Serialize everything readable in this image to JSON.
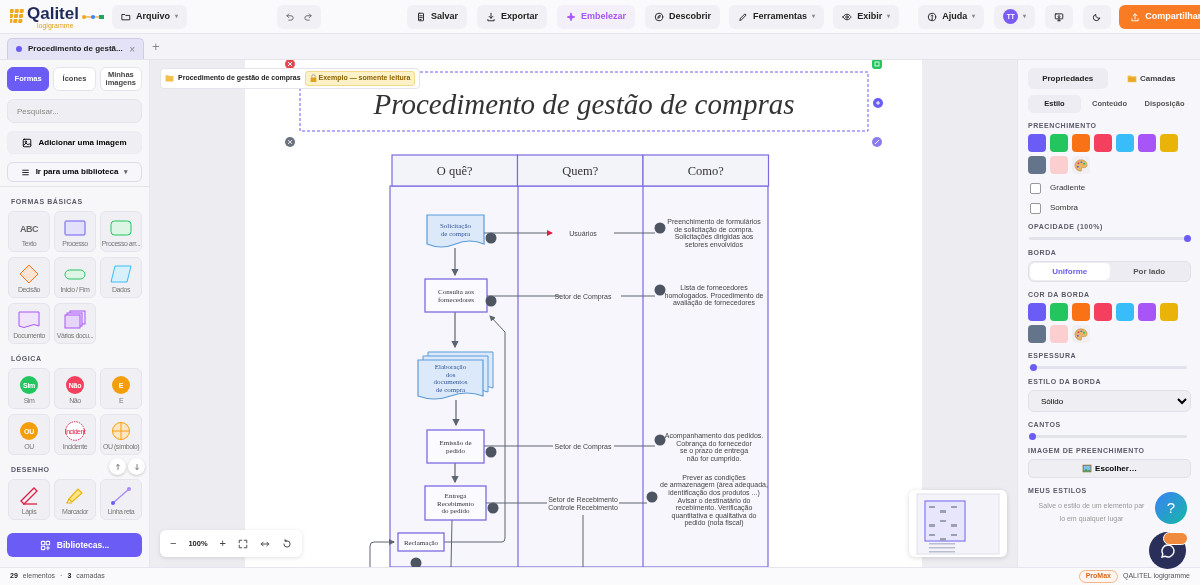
{
  "logo": {
    "name": "Qalitel",
    "tagline": "logigramme"
  },
  "toolbar": [
    {
      "kind": "menu",
      "label": "Arquivo",
      "caret": "▾"
    },
    {
      "kind": "history"
    },
    {
      "kind": "button",
      "label": "Salvar"
    },
    {
      "kind": "button",
      "label": "Exportar"
    },
    {
      "kind": "accent",
      "label": "Embelezar"
    },
    {
      "kind": "button",
      "label": "Descobrir"
    },
    {
      "kind": "menu",
      "label": "Ferramentas",
      "caret": "▾"
    },
    {
      "kind": "menu",
      "label": "Exibir",
      "caret": "▾"
    },
    {
      "kind": "menu",
      "label": "Ajuda",
      "caret": "▾"
    },
    {
      "kind": "avatar",
      "initials": "TT",
      "caret": "▾"
    },
    {
      "kind": "icon"
    },
    {
      "kind": "icon"
    },
    {
      "kind": "primary",
      "label": "Compartilhar"
    }
  ],
  "document_tabs": [
    {
      "label": "Procedimento de gestã...",
      "selected": true,
      "close": "×"
    }
  ],
  "new_tab": "+",
  "sidebar": {
    "tabs": [
      {
        "label": "Formas",
        "selected": true
      },
      {
        "label": "Ícones",
        "selected": false
      },
      {
        "label": "Minhas imagens",
        "selected": false
      }
    ],
    "search": {
      "placeholder": "Pesquisar..."
    },
    "add_image": "Adicionar uma imagem",
    "library_menu": {
      "label": "Ir para uma biblioteca",
      "caret": "▾"
    },
    "sections": [
      {
        "title": "FORMAS BÁSICAS",
        "items": [
          {
            "label": "Texto",
            "kind": "text",
            "glyph": "ABC"
          },
          {
            "label": "Processo",
            "kind": "process"
          },
          {
            "label": "Processo arr...",
            "kind": "rounded"
          },
          {
            "label": "Decisão",
            "kind": "decision"
          },
          {
            "label": "Início / Fim",
            "kind": "terminal"
          },
          {
            "label": "Dados",
            "kind": "data"
          },
          {
            "label": "Documento",
            "kind": "document"
          },
          {
            "label": "Vários docu...",
            "kind": "documents"
          }
        ]
      },
      {
        "title": "LÓGICA",
        "items": [
          {
            "label": "Sim",
            "kind": "badge",
            "glyph": "Sim",
            "color": "#22c55e"
          },
          {
            "label": "Não",
            "kind": "badge",
            "glyph": "Não",
            "color": "#f43f5e"
          },
          {
            "label": "E",
            "kind": "badge",
            "glyph": "E",
            "color": "#f59e0b"
          },
          {
            "label": "OU",
            "kind": "badge",
            "glyph": "OU",
            "color": "#f59e0b"
          },
          {
            "label": "Incidente",
            "kind": "incident",
            "glyph": "Incident"
          },
          {
            "label": "OU (símbolo)",
            "kind": "or-symbol"
          }
        ]
      },
      {
        "title": "DESENHO",
        "items": [
          {
            "label": "Lápis",
            "kind": "pencil"
          },
          {
            "label": "Marcador",
            "kind": "marker"
          },
          {
            "label": "Linha reta",
            "kind": "line"
          }
        ]
      }
    ],
    "libraries_button": "Bibliotecas..."
  },
  "status": {
    "count": "29",
    "count_label": "elementos",
    "separator": "·",
    "layers": "3",
    "layers_label": "camadas"
  },
  "canvas": {
    "breadcrumb": "Procedimento de gestão de compras",
    "readonly_badge": "Exemplo — somente leitura",
    "title": "Procedimento de gestão de compras",
    "diagram": {
      "columns": [
        "O quê?",
        "Quem?",
        "Como?"
      ],
      "steps": [
        {
          "kind": "document",
          "text": "Solicitação\nde compra"
        },
        {
          "kind": "process",
          "text": "Consulta aos\nfornecedores"
        },
        {
          "kind": "multidocument",
          "text": "Elaboração\ndos\ndocumentos\nde compra"
        },
        {
          "kind": "process",
          "text": "Emissão de\npedido"
        },
        {
          "kind": "process",
          "text": "Entrega\nRecebimento\ndo pedido"
        },
        {
          "kind": "process",
          "text": "Reclamação"
        }
      ],
      "rows": [
        {
          "who": "Usuários",
          "how": "Preenchimento de formulários\nde solicitação de compra.\nSolicitações dirigidas aos\nsetores envolvidos"
        },
        {
          "who": "Setor de Compras",
          "how": "Lista de fornecedores\nhomologados. Procedimento de\navaliação de fornecedores"
        },
        {
          "who": "Setor de Compras",
          "how": "Acompanhamento dos pedidos.\nCobrança do fornecedor\nse o prazo de entrega\nnão for cumprido."
        },
        {
          "who": "Setor de Recebimento\nControle Recebimento",
          "how": "Prever as condições\nde armazenagem (área adequada,\nidentificação dos produtos ...)\nAvisar o destinatário do\nrecebimento. Verificação\nquantitativa e qualitativa do\npedido (nota fiscal)"
        }
      ]
    }
  },
  "zoom": {
    "minus": "−",
    "level": "100%",
    "plus": "+"
  },
  "properties": {
    "tabs": [
      {
        "label": "Propriedades",
        "selected": true
      },
      {
        "label": "Camadas",
        "selected": false
      }
    ],
    "subtabs": [
      {
        "label": "Estilo",
        "selected": true
      },
      {
        "label": "Conteúdo",
        "selected": false
      },
      {
        "label": "Disposição",
        "selected": false
      }
    ],
    "fill": {
      "title": "PREENCHIMENTO",
      "swatches": [
        {
          "kind": "color",
          "color": "#6a5cf5"
        },
        {
          "kind": "color",
          "color": "#22c55e"
        },
        {
          "kind": "color",
          "color": "#f97316"
        },
        {
          "kind": "color",
          "color": "#f43f5e"
        },
        {
          "kind": "color",
          "color": "#38bdf8"
        },
        {
          "kind": "color",
          "color": "#a855f7"
        },
        {
          "kind": "color",
          "color": "#eab308"
        },
        {
          "kind": "color",
          "color": "#64748b"
        },
        {
          "kind": "color",
          "color": "#fbcfcf"
        },
        {
          "kind": "palette"
        }
      ]
    },
    "options": [
      {
        "label": "Gradiente",
        "checked": false
      },
      {
        "label": "Sombra",
        "checked": false
      }
    ],
    "opacity": {
      "title": "OPACIDADE (100%)",
      "level": 1
    },
    "border": {
      "title": "BORDA",
      "modes": [
        {
          "label": "Uniforme",
          "selected": true
        },
        {
          "label": "Por lado",
          "selected": false
        }
      ]
    },
    "border_color": {
      "title": "COR DA BORDA",
      "swatches": [
        {
          "kind": "color",
          "color": "#6a5cf5"
        },
        {
          "kind": "color",
          "color": "#22c55e"
        },
        {
          "kind": "color",
          "color": "#f97316"
        },
        {
          "kind": "color",
          "color": "#f43f5e"
        },
        {
          "kind": "color",
          "color": "#38bdf8"
        },
        {
          "kind": "color",
          "color": "#a855f7"
        },
        {
          "kind": "color",
          "color": "#eab308"
        },
        {
          "kind": "color",
          "color": "#64748b"
        },
        {
          "kind": "color",
          "color": "#fbcfcf"
        },
        {
          "kind": "palette"
        }
      ]
    },
    "thickness": {
      "title": "ESPESSURA",
      "level": 0.03
    },
    "border_style": {
      "title": "ESTILO DA BORDA",
      "value": "Sólido"
    },
    "corners": {
      "title": "CANTOS",
      "level": 0.02
    },
    "fill_image": {
      "title": "IMAGEM DE PREENCHIMENTO",
      "button": "Escolher…"
    },
    "my_styles": {
      "title": "MEUS ESTILOS",
      "hint_lines": [
        "Salve o estilo de um elemento par",
        "lo em qualquer lugar"
      ]
    }
  },
  "footer": {
    "plan": "ProMax",
    "product": "QALITEL logigramme"
  },
  "help": "?"
}
